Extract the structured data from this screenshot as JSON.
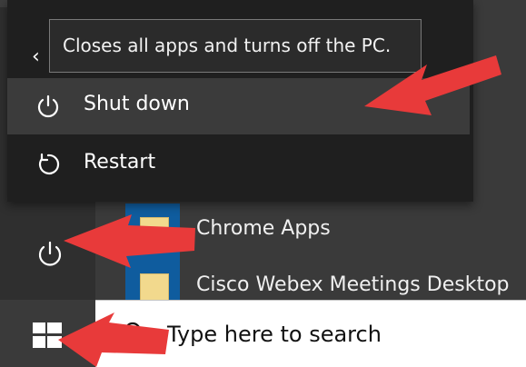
{
  "start_menu": {
    "apps": [
      {
        "label": "Chrome Apps",
        "icon": "folder-icon"
      },
      {
        "label": "Cisco Webex Meetings Desktop",
        "icon": "folder-icon"
      }
    ],
    "power_flyout": {
      "tooltip": "Closes all apps and turns off the PC.",
      "items": [
        {
          "label": "Shut down",
          "icon": "power-icon",
          "selected": true
        },
        {
          "label": "Restart",
          "icon": "restart-icon",
          "selected": false
        }
      ]
    }
  },
  "taskbar": {
    "search_placeholder": "Type here to search"
  },
  "colors": {
    "annotation_arrow": "#e83a3a",
    "selection": "#3b3b3b",
    "tooltip_border": "#797979"
  }
}
